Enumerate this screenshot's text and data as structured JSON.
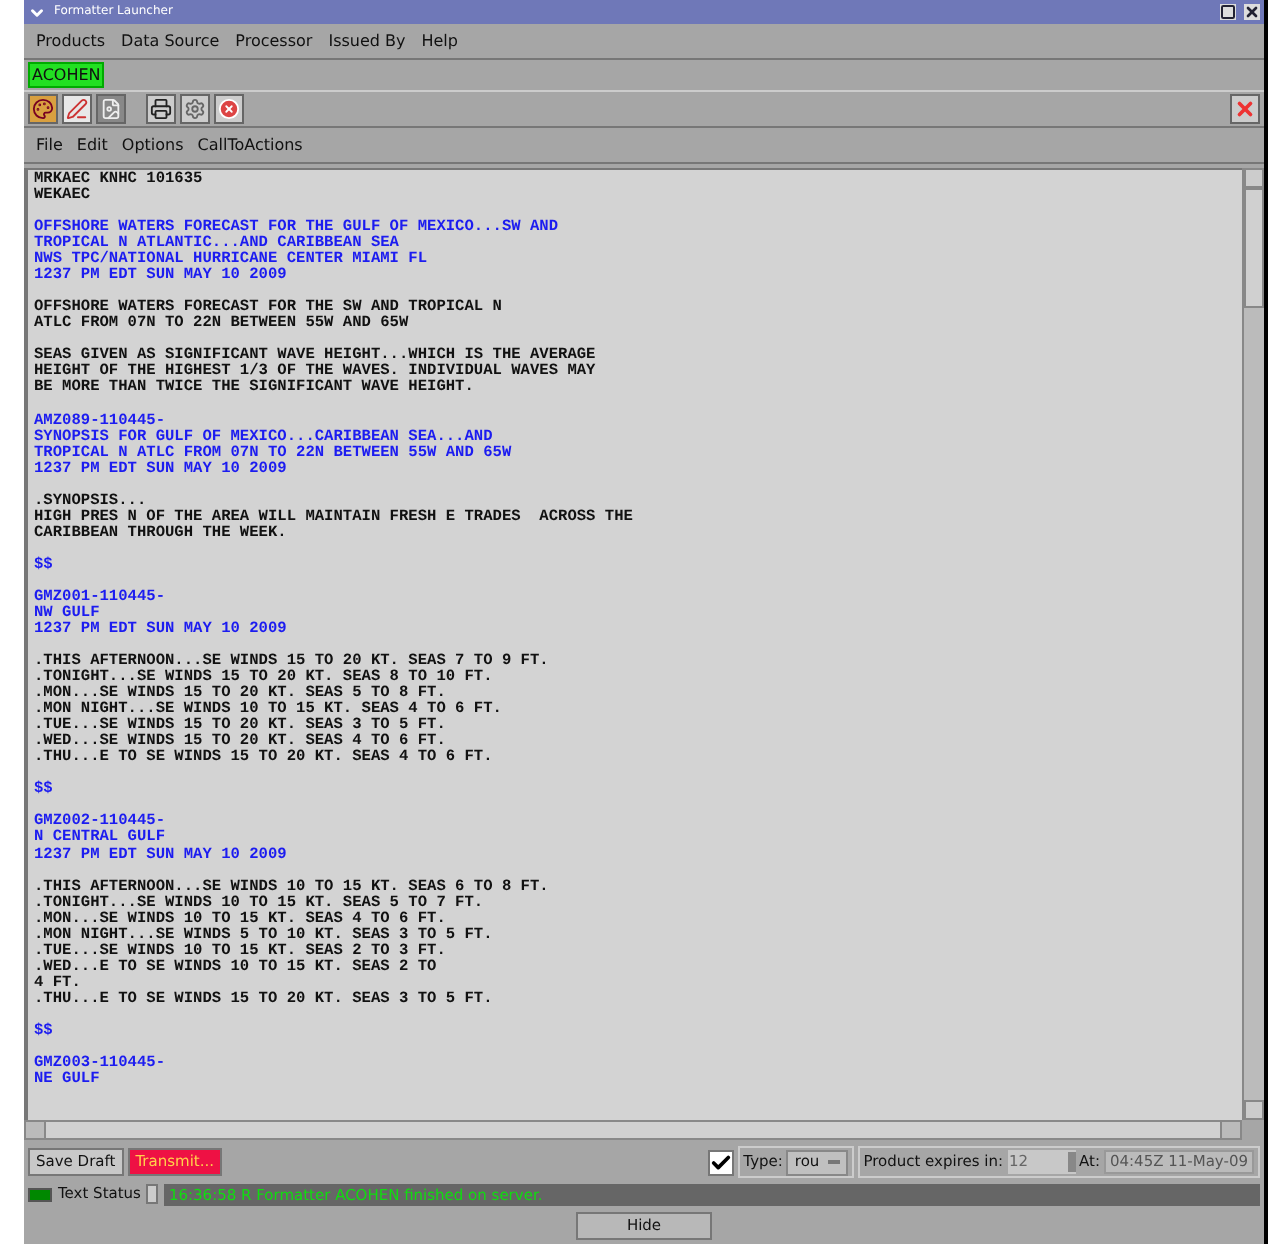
{
  "window": {
    "title": "Formatter Launcher"
  },
  "menu_bar": [
    "Products",
    "Data Source",
    "Processor",
    "Issued By",
    "Help"
  ],
  "user": {
    "name": "ACOHEN"
  },
  "editor_menu": [
    "File",
    "Edit",
    "Options",
    "CallToActions"
  ],
  "editor": {
    "blocks": [
      {
        "kind": "plain",
        "lines": [
          "MRKAEC KNHC 101635",
          "WEKAEC"
        ]
      },
      {
        "kind": "locked",
        "lines": [
          "OFFSHORE WATERS FORECAST FOR THE GULF OF MEXICO...SW AND",
          "TROPICAL N ATLANTIC...AND CARIBBEAN SEA",
          "NWS TPC/NATIONAL HURRICANE CENTER MIAMI FL",
          "1237 PM EDT SUN MAY 10 2009"
        ]
      },
      {
        "kind": "plain",
        "lines": [
          "OFFSHORE WATERS FORECAST FOR THE SW AND TROPICAL N",
          "ATLC FROM 07N TO 22N BETWEEN 55W AND 65W"
        ]
      },
      {
        "kind": "plain",
        "lines": [
          "SEAS GIVEN AS SIGNIFICANT WAVE HEIGHT...WHICH IS THE AVERAGE",
          "HEIGHT OF THE HIGHEST 1/3 OF THE WAVES. INDIVIDUAL WAVES MAY",
          "BE MORE THAN TWICE THE SIGNIFICANT WAVE HEIGHT."
        ]
      },
      {
        "kind": "locked",
        "lines": [
          "AMZ089-110445-",
          "SYNOPSIS FOR GULF OF MEXICO...CARIBBEAN SEA...AND",
          "TROPICAL N ATLC FROM 07N TO 22N BETWEEN 55W AND 65W",
          "1237 PM EDT SUN MAY 10 2009"
        ]
      },
      {
        "kind": "plain",
        "lines": [
          ".SYNOPSIS...",
          "HIGH PRES N OF THE AREA WILL MAINTAIN FRESH E TRADES  ACROSS THE",
          "CARIBBEAN THROUGH THE WEEK."
        ]
      },
      {
        "kind": "locked",
        "lines": [
          "$$"
        ]
      },
      {
        "kind": "locked",
        "lines": [
          "GMZ001-110445-",
          "NW GULF",
          "1237 PM EDT SUN MAY 10 2009"
        ]
      },
      {
        "kind": "plain",
        "lines": [
          ".THIS AFTERNOON...SE WINDS 15 TO 20 KT. SEAS 7 TO 9 FT.",
          ".TONIGHT...SE WINDS 15 TO 20 KT. SEAS 8 TO 10 FT.",
          ".MON...SE WINDS 15 TO 20 KT. SEAS 5 TO 8 FT.",
          ".MON NIGHT...SE WINDS 10 TO 15 KT. SEAS 4 TO 6 FT.",
          ".TUE...SE WINDS 15 TO 20 KT. SEAS 3 TO 5 FT.",
          ".WED...SE WINDS 15 TO 20 KT. SEAS 4 TO 6 FT.",
          ".THU...E TO SE WINDS 15 TO 20 KT. SEAS 4 TO 6 FT."
        ]
      },
      {
        "kind": "locked",
        "lines": [
          "$$"
        ]
      },
      {
        "kind": "locked",
        "lines": [
          "GMZ002-110445-",
          "N CENTRAL GULF",
          "1237 PM EDT SUN MAY 10 2009"
        ]
      },
      {
        "kind": "plain",
        "lines": [
          ".THIS AFTERNOON...SE WINDS 10 TO 15 KT. SEAS 6 TO 8 FT.",
          ".TONIGHT...SE WINDS 10 TO 15 KT. SEAS 5 TO 7 FT.",
          ".MON...SE WINDS 10 TO 15 KT. SEAS 4 TO 6 FT.",
          ".MON NIGHT...SE WINDS 5 TO 10 KT. SEAS 3 TO 5 FT.",
          ".TUE...SE WINDS 10 TO 15 KT. SEAS 2 TO 3 FT.",
          ".WED...E TO SE WINDS 10 TO 15 KT. SEAS 2 TO",
          "4 FT.",
          ".THU...E TO SE WINDS 15 TO 20 KT. SEAS 3 TO 5 FT."
        ]
      },
      {
        "kind": "locked",
        "lines": [
          "$$"
        ]
      },
      {
        "kind": "locked",
        "lines": [
          "GMZ003-110445-",
          "NE GULF"
        ]
      }
    ]
  },
  "actions": {
    "save": "Save Draft",
    "transmit": "Transmit...",
    "auto_checked": true,
    "type_label": "Type:",
    "type_value": "rou",
    "expires_label": "Product expires in:",
    "expires_value": "12",
    "at_label": "At:",
    "at_value": "04:45Z 11-May-09"
  },
  "status": {
    "label": "Text Status",
    "message": "16:36:58 R Formatter ACOHEN finished on server."
  },
  "hide_button": "Hide"
}
